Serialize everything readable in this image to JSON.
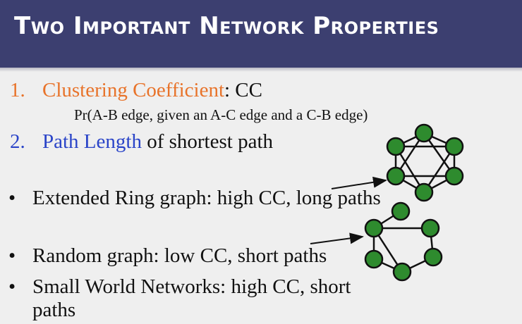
{
  "slide": {
    "title": "Two Important Network Properties",
    "item1": {
      "num": "1.",
      "term": "Clustering Coefficient",
      "rest": ": CC"
    },
    "item1_detail": "Pr(A-B edge, given an A-C edge and a C-B edge)",
    "item2": {
      "num": "2.",
      "term": "Path Length",
      "rest": " of shortest path"
    },
    "bullets": [
      {
        "marker": "•",
        "text": "Extended Ring graph: high CC, long paths"
      },
      {
        "marker": "•",
        "text": "Random graph: low CC, short paths"
      },
      {
        "marker": "•",
        "text": "Small World Networks: high CC, short",
        "continuation": "paths"
      }
    ]
  },
  "colors": {
    "header": "#3c3f70",
    "accent_orange": "#e8732a",
    "accent_blue": "#2a44c8",
    "node_fill": "#2e8b2e"
  }
}
